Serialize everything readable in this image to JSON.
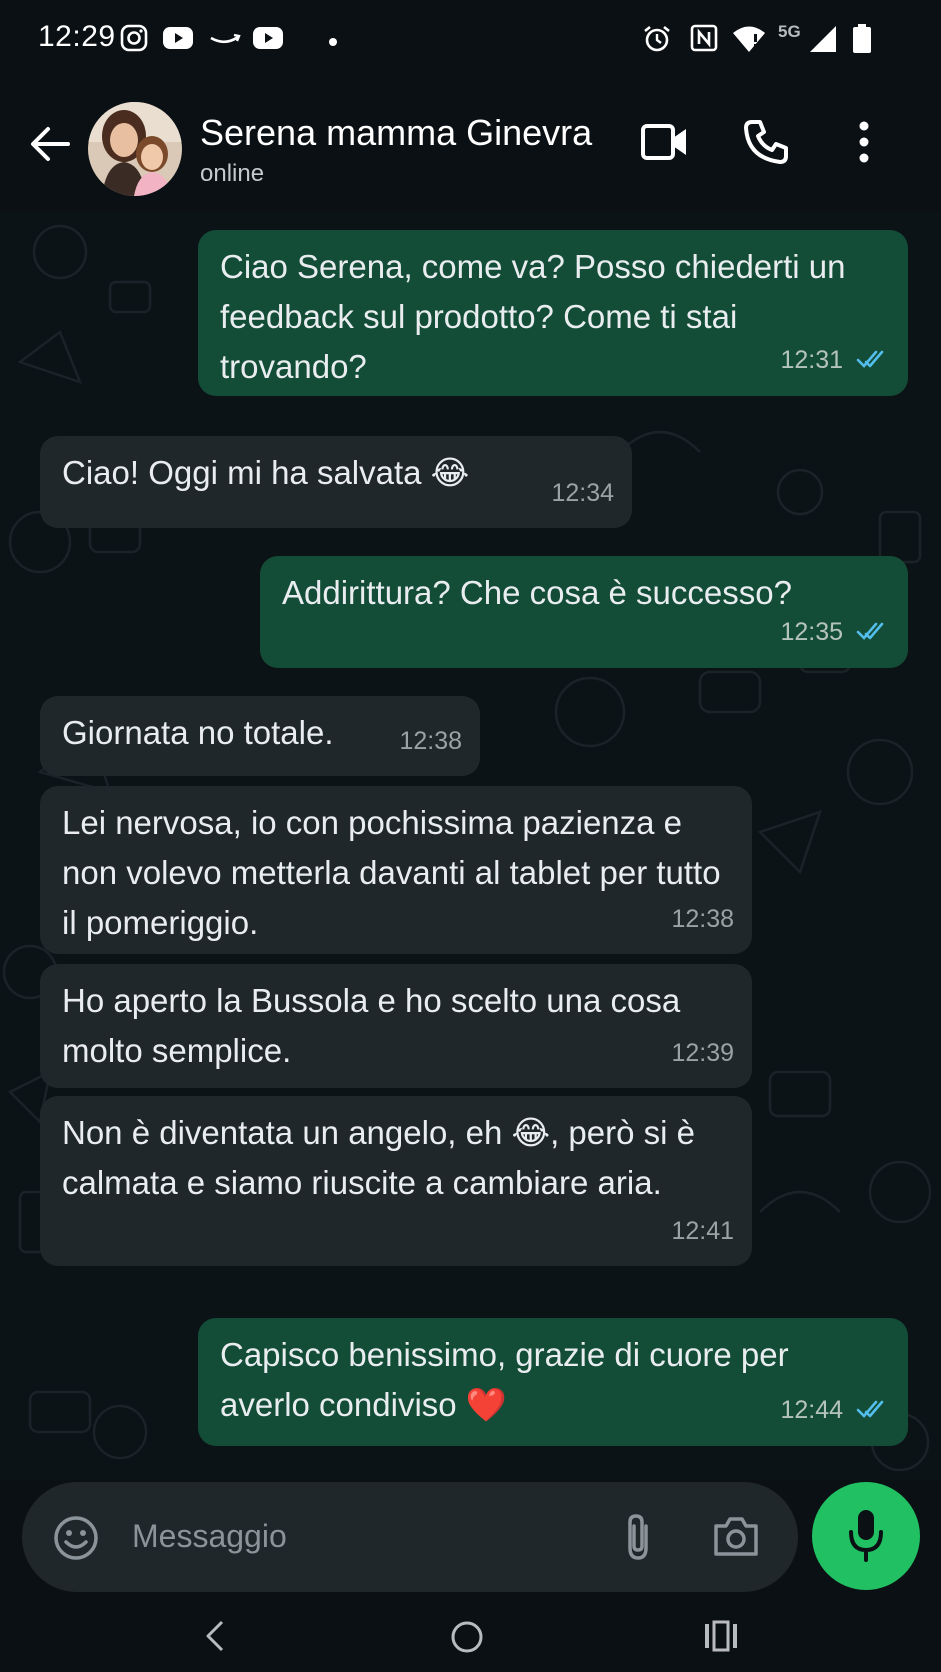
{
  "status_bar": {
    "time": "12:29",
    "network": "5G",
    "icons": [
      "instagram-icon",
      "youtube-icon",
      "amazon-icon",
      "youtube-icon",
      "dot-icon",
      "alarm-icon",
      "nfc-icon",
      "wifi-icon",
      "signal-icon",
      "battery-icon"
    ]
  },
  "header": {
    "contact_name": "Serena mamma Ginevra",
    "status": "online",
    "icons": [
      "back-arrow-icon",
      "video-call-icon",
      "phone-icon",
      "more-vert-icon"
    ]
  },
  "messages": [
    {
      "direction": "outgoing",
      "text": "Ciao Serena, come va? Posso chiederti un feedback sul prodotto? Come ti stai trovando?",
      "time": "12:31",
      "read": true
    },
    {
      "direction": "incoming",
      "text": "Ciao! Oggi mi ha salvata 😂",
      "time": "12:34"
    },
    {
      "direction": "outgoing",
      "text": "Addirittura? Che cosa è successo?",
      "time": "12:35",
      "read": true
    },
    {
      "direction": "incoming",
      "text": "Giornata no totale.",
      "time": "12:38"
    },
    {
      "direction": "incoming",
      "text": "Lei nervosa, io con pochissima pazienza e non volevo metterla davanti al tablet per tutto il pomeriggio.",
      "time": "12:38"
    },
    {
      "direction": "incoming",
      "text": "Ho aperto la Bussola e ho scelto una cosa molto semplice.",
      "time": "12:39"
    },
    {
      "direction": "incoming",
      "text": "Non è diventata un angelo, eh 😂, però si è calmata e siamo riuscite a cambiare aria.",
      "time": "12:41"
    },
    {
      "direction": "outgoing",
      "text": "Capisco benissimo, grazie di cuore per averlo condiviso ❤️",
      "time": "12:44",
      "read": true
    }
  ],
  "composer": {
    "placeholder": "Messaggio",
    "icons": [
      "emoji-icon",
      "attach-icon",
      "camera-icon",
      "mic-icon"
    ]
  },
  "colors": {
    "background": "#0b1014",
    "outgoing_bubble": "#134d37",
    "incoming_bubble": "#1f272a",
    "read_ticks": "#53bdeb",
    "mic_button": "#21c063"
  }
}
